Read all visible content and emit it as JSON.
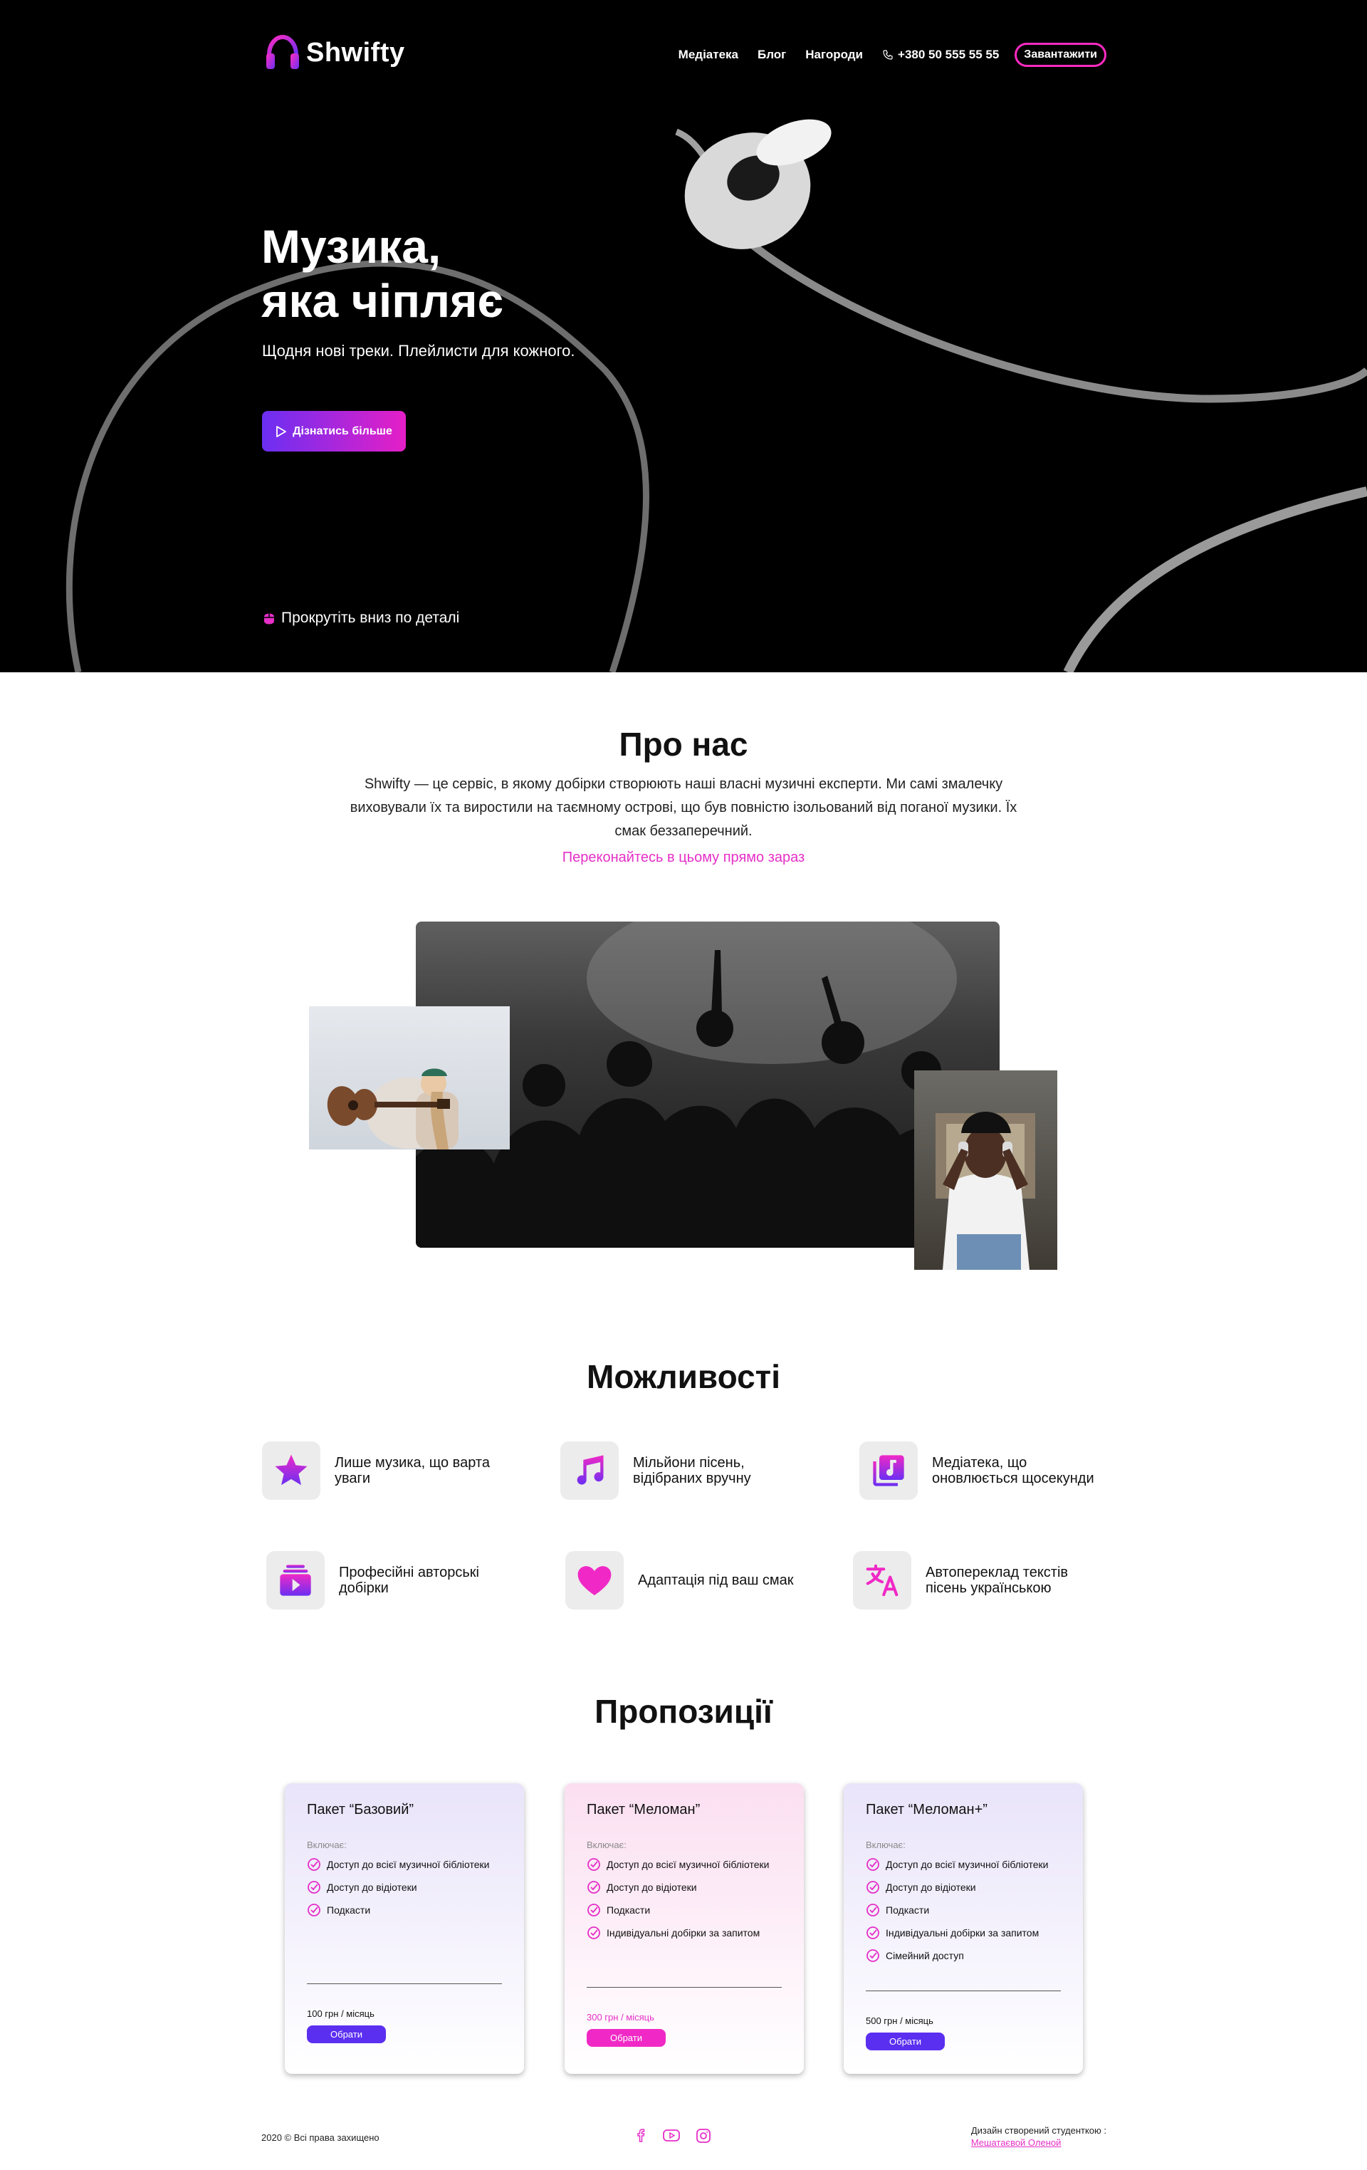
{
  "brand": {
    "name": "Shwifty"
  },
  "nav": {
    "items": [
      "Медіатека",
      "Блог",
      "Нагороди"
    ],
    "phone": "+380 50 555 55 55",
    "download_label": "Завантажити"
  },
  "hero": {
    "title_line1": "Музика,",
    "title_line2": "яка чіпляє",
    "subtitle": "Щодня нові треки. Плейлисти для кожного.",
    "cta_label": "Дізнатись більше",
    "scroll_hint": "Прокрутіть вниз по деталі"
  },
  "about": {
    "title": "Про нас",
    "text": "Shwifty — це сервіс, в якому добірки створюють наші власні музичні експерти. Ми самі змалечку виховували їх та виростили на таємному острові, що був повністю ізольований від поганої музики. Їх смак беззаперечний.",
    "link": "Переконайтесь в цьому прямо зараз"
  },
  "features": {
    "title": "Можливості",
    "items": [
      {
        "label": "Лише музика, що варта уваги",
        "icon": "star-icon"
      },
      {
        "label": "Мільйони пісень, відібраних вручну",
        "icon": "music-note-icon"
      },
      {
        "label": "Медіатека, що оновлюється щосекунди",
        "icon": "library-icon"
      },
      {
        "label": "Професійні авторські добірки",
        "icon": "playlist-icon"
      },
      {
        "label": "Адаптація під ваш смак",
        "icon": "heart-icon"
      },
      {
        "label": "Автопереклад текстів пісень українською",
        "icon": "translate-icon"
      }
    ]
  },
  "offers": {
    "title": "Пропозиції",
    "included_label": "Включає:",
    "choose_label": "Обрати",
    "cards": [
      {
        "name": "Пакет “Базовий”",
        "features": [
          "Доступ до всієї музичної бібліотеки",
          "Доступ до відіотеки",
          "Подкасти"
        ],
        "price": "100 грн / місяць"
      },
      {
        "name": "Пакет “Меломан”",
        "features": [
          "Доступ до всієї музичної бібліотеки",
          "Доступ до відіотеки",
          "Подкасти",
          "Індивідуальні добірки за запитом"
        ],
        "price": "300 грн / місяць"
      },
      {
        "name": "Пакет “Меломан+”",
        "features": [
          "Доступ до всієї музичної бібліотеки",
          "Доступ до відіотеки",
          "Подкасти",
          "Індивідуальні добірки за запитом",
          "Сімейний доступ"
        ],
        "price": "500 грн / місяць"
      }
    ]
  },
  "footer": {
    "copyright": "2020 © Всі права захищено",
    "credit": "Дизайн створений студенткою :",
    "author": "Мешатаєвой Оленой",
    "socials": [
      "facebook-icon",
      "youtube-icon",
      "instagram-icon"
    ]
  },
  "colors": {
    "accent_pink": "#e52fc7",
    "accent_violet": "#5b2ff0",
    "hero_bg": "#000000"
  }
}
